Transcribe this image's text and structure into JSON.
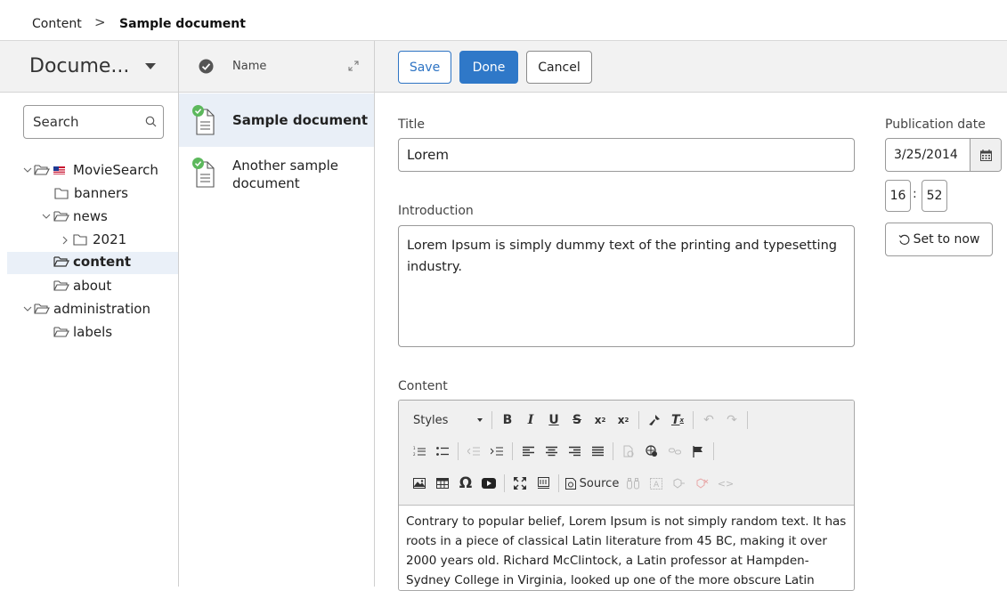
{
  "breadcrumb": {
    "root": "Content",
    "separator": ">",
    "current": "Sample document"
  },
  "tree_panel": {
    "header": "Docume...",
    "search_placeholder": "Search",
    "items": [
      {
        "label": "MovieSearch",
        "expanded": true
      },
      {
        "label": "banners"
      },
      {
        "label": "news",
        "expanded": true
      },
      {
        "label": "2021",
        "expanded": false
      },
      {
        "label": "content",
        "selected": true
      },
      {
        "label": "about"
      },
      {
        "label": "administration",
        "expanded": true
      },
      {
        "label": "labels"
      }
    ]
  },
  "doc_list": {
    "column": "Name",
    "items": [
      {
        "title": "Sample document",
        "selected": true
      },
      {
        "title_line1": "Another sample",
        "title_line2": "document"
      }
    ]
  },
  "toolbar": {
    "save": "Save",
    "done": "Done",
    "cancel": "Cancel"
  },
  "form": {
    "title_label": "Title",
    "title_value": "Lorem",
    "intro_label": "Introduction",
    "intro_value": "Lorem Ipsum is simply dummy text of the printing and typesetting industry.",
    "content_label": "Content",
    "content_value": "Contrary to popular belief, Lorem Ipsum is not simply random text. It has roots in a piece of classical Latin literature from 45 BC, making it over 2000 years old. Richard McClintock, a Latin professor at Hampden-Sydney College in Virginia, looked up one of the more obscure Latin words,",
    "pub_label": "Publication date",
    "pub_date": "3/25/2014",
    "pub_hour": "16",
    "pub_minute": "52",
    "set_now": "Set to now"
  },
  "rte": {
    "styles_label": "Styles",
    "source_label": "Source"
  },
  "colors": {
    "accent": "#2f78c8",
    "selection": "#e9eff7",
    "header_bg": "#f2f2f2",
    "check_green": "#5cb85c"
  }
}
